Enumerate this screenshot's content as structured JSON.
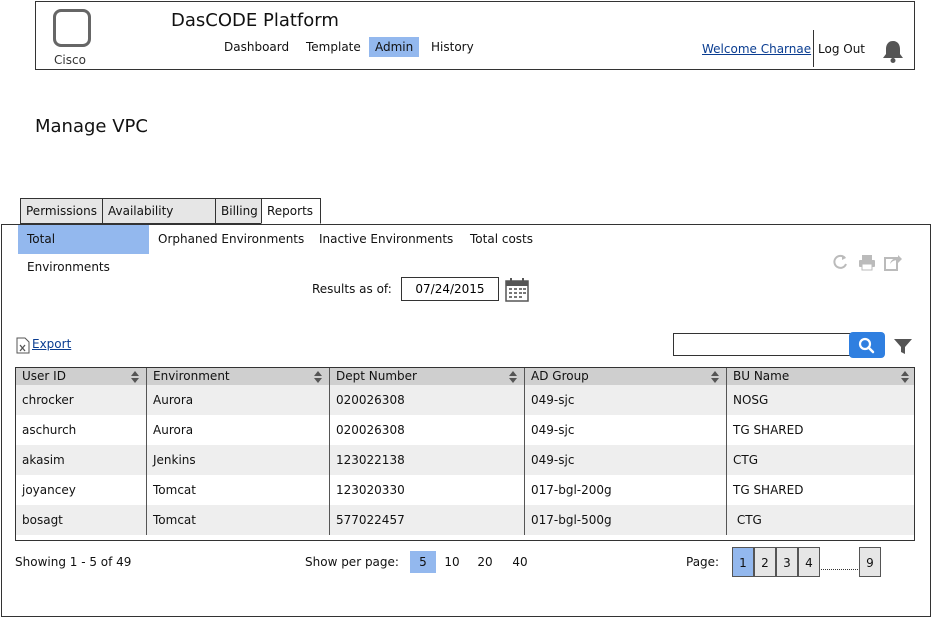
{
  "header": {
    "app_title": "DasCODE Platform",
    "logo_text": "Cisco",
    "nav": [
      "Dashboard",
      "Template",
      "Admin",
      "History"
    ],
    "active_nav": "Admin",
    "welcome": "Welcome Charnae",
    "logout": "Log Out"
  },
  "page_title": "Manage VPC",
  "tabs": [
    "Permissions",
    "Availability Zones",
    "Billing",
    "Reports"
  ],
  "active_tab": "Reports",
  "subtabs": [
    "Total Environments",
    "Orphaned Environments",
    "Inactive Environments",
    "Total costs"
  ],
  "active_subtab": "Total Environments",
  "results": {
    "label": "Results as of:",
    "date": "07/24/2015"
  },
  "export_label": "Export",
  "search": {
    "value": "",
    "placeholder": ""
  },
  "table": {
    "columns": [
      "User ID",
      "Environment",
      "Dept Number",
      "AD Group",
      "BU Name"
    ],
    "rows": [
      [
        "chrocker",
        "Aurora",
        "020026308",
        "049-sjc",
        "NOSG"
      ],
      [
        "aschurch",
        "Aurora",
        "020026308",
        "049-sjc",
        "TG SHARED"
      ],
      [
        "akasim",
        "Jenkins",
        "123022138",
        "049-sjc",
        "CTG"
      ],
      [
        "joyancey",
        "Tomcat",
        "123020330",
        "017-bgl-200g",
        "TG SHARED"
      ],
      [
        "bosagt",
        "Tomcat",
        "577022457",
        "017-bgl-500g",
        " CTG"
      ]
    ]
  },
  "footer": {
    "showing": "Showing 1 - 5 of 49",
    "per_page_label": "Show per page:",
    "per_page_options": [
      "5",
      "10",
      "20",
      "40"
    ],
    "per_page_selected": "5",
    "page_label": "Page:",
    "pages": [
      "1",
      "2",
      "3",
      "4",
      "9"
    ],
    "current_page": "1"
  },
  "colors": {
    "accent": "#93b8ee",
    "search_button": "#2f7fe0",
    "link": "#0a3d91"
  },
  "icons": [
    "bell-icon",
    "refresh-icon",
    "print-icon",
    "share-icon",
    "calendar-icon",
    "excel-export-icon",
    "search-icon",
    "filter-icon",
    "sort-icon"
  ]
}
